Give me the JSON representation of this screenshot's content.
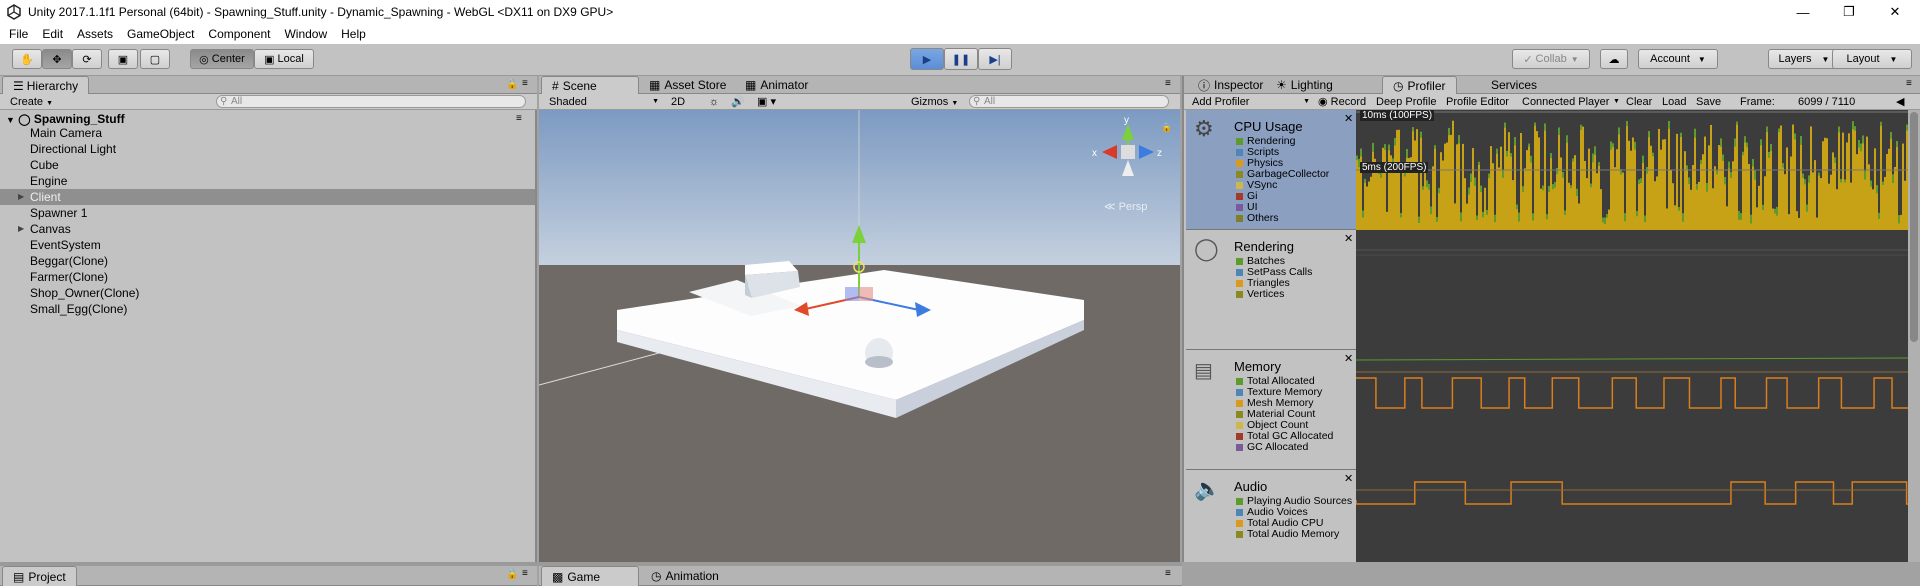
{
  "window": {
    "title": "Unity 2017.1.1f1 Personal (64bit) - Spawning_Stuff.unity - Dynamic_Spawning - WebGL <DX11 on DX9 GPU>"
  },
  "menu": [
    "File",
    "Edit",
    "Assets",
    "GameObject",
    "Component",
    "Window",
    "Help"
  ],
  "toolbar": {
    "center": "Center",
    "local": "Local",
    "collab": "Collab",
    "account": "Account",
    "layers": "Layers",
    "layout": "Layout"
  },
  "hierarchy": {
    "tab": "Hierarchy",
    "create": "Create",
    "search": "All",
    "scene": "Spawning_Stuff",
    "items": [
      "Main Camera",
      "Directional Light",
      "Cube",
      "Engine",
      "Client",
      "Spawner 1",
      "Canvas",
      "EventSystem",
      "Beggar(Clone)",
      "Farmer(Clone)",
      "Shop_Owner(Clone)",
      "Small_Egg(Clone)"
    ]
  },
  "scene": {
    "tabs": [
      "Scene",
      "Asset Store",
      "Animator"
    ],
    "shaded": "Shaded",
    "twod": "2D",
    "gizmos": "Gizmos",
    "search": "All",
    "persp": "Persp"
  },
  "profiler": {
    "tabs": [
      "Inspector",
      "Lighting",
      "Profiler",
      "Services"
    ],
    "add": "Add Profiler",
    "record": "Record",
    "deep": "Deep Profile",
    "editor": "Profile Editor",
    "connected": "Connected Player",
    "clear": "Clear",
    "load": "Load",
    "save": "Save",
    "frame_label": "Frame:",
    "frame_value": "6099 / 7110",
    "cpu": {
      "title": "CPU Usage",
      "items": [
        "Rendering",
        "Scripts",
        "Physics",
        "GarbageCollector",
        "VSync",
        "Gi",
        "UI",
        "Others"
      ],
      "label_10ms": "10ms (100FPS)",
      "label_5ms": "5ms (200FPS)"
    },
    "rendering": {
      "title": "Rendering",
      "items": [
        "Batches",
        "SetPass Calls",
        "Triangles",
        "Vertices"
      ]
    },
    "memory": {
      "title": "Memory",
      "items": [
        "Total Allocated",
        "Texture Memory",
        "Mesh Memory",
        "Material Count",
        "Object Count",
        "Total GC Allocated",
        "GC Allocated"
      ]
    },
    "audio": {
      "title": "Audio",
      "items": [
        "Playing Audio Sources",
        "Audio Voices",
        "Total Audio CPU",
        "Total Audio Memory"
      ]
    }
  },
  "bottom": {
    "project": "Project",
    "game": "Game",
    "animation": "Animation"
  },
  "colors": {
    "rendering": "#5d9b2f",
    "scripts": "#4f86b6",
    "physics": "#d99a1d",
    "gc": "#8a8a20",
    "vsync": "#cfb84b",
    "gi": "#a33b2a",
    "ui": "#7a5a9a",
    "others": "#7f7f2a",
    "cpu_bar": "#c8a216",
    "memory_line": "#d87e1c"
  }
}
